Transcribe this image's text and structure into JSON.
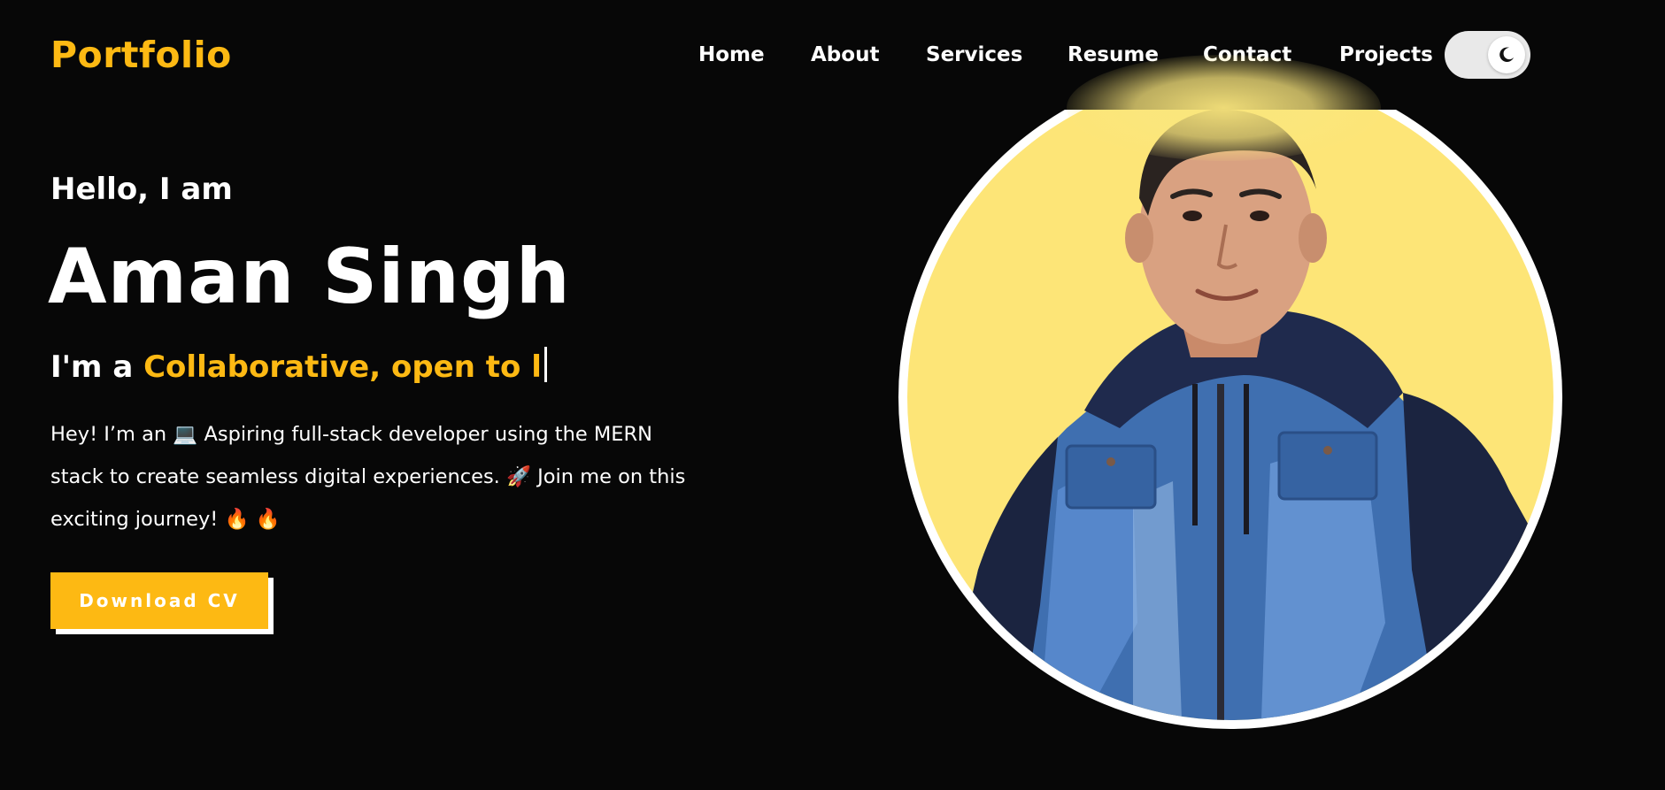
{
  "brand": {
    "logo": "Portfolio",
    "accent_color": "#FDB913"
  },
  "nav": {
    "items": [
      "Home",
      "About",
      "Services",
      "Resume",
      "Contact",
      "Projects"
    ],
    "theme_toggle_icon": "moon-icon"
  },
  "hero": {
    "greeting": "Hello, I am",
    "name": "Aman Singh",
    "typed_prefix": "I'm a ",
    "typed_text": "Collaborative, open to l",
    "intro": "Hey! I’m an 💻 Aspiring full-stack developer using the MERN stack to create seamless digital experiences. 🚀 Join me on this exciting journey! 🔥 🔥",
    "cta_label": "Download CV"
  },
  "photo": {
    "background_color": "#FDE577"
  }
}
